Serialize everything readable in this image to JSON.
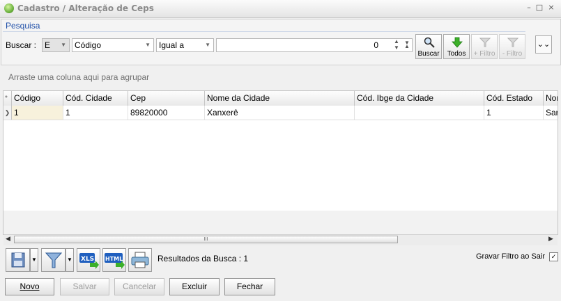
{
  "window": {
    "title": "Cadastro / Alteração de Ceps",
    "controls": {
      "minimize": "–",
      "maximize": "□",
      "close": "×"
    }
  },
  "search": {
    "section_label": "Pesquisa",
    "buscar_label": "Buscar :",
    "operator": "E",
    "field": "Código",
    "comparison": "Igual a",
    "value": "0",
    "buttons": {
      "buscar": "Buscar",
      "todos": "Todos",
      "add_filtro": "+ Filtro",
      "remove_filtro": "- Filtro"
    }
  },
  "grid": {
    "group_hint": "Arraste uma coluna aqui para agrupar",
    "indicator_header": "*",
    "columns": [
      "Código",
      "Cód. Cidade",
      "Cep",
      "Nome da Cidade",
      "Cód. Ibge da Cidade",
      "Cód. Estado",
      "Nor"
    ],
    "rows": [
      [
        "1",
        "1",
        "89820000",
        "Xanxerê",
        "",
        "1",
        "Sar"
      ]
    ],
    "row_indicator": "❯",
    "scroll_thumb": "III"
  },
  "footer": {
    "results_text": "Resultados da Busca : 1",
    "gravar_filtro_label": "Gravar Filtro ao Sair",
    "gravar_filtro_checked": true,
    "check_mark": "✓"
  },
  "actions": {
    "novo": "Novo",
    "salvar": "Salvar",
    "cancelar": "Cancelar",
    "excluir": "Excluir",
    "fechar": "Fechar"
  },
  "colors": {
    "pesquisa": "#1f4fa8",
    "todos_arrow": "#3cb029",
    "xls_badge": "#1f5fbf",
    "html_badge": "#1f5fbf"
  }
}
